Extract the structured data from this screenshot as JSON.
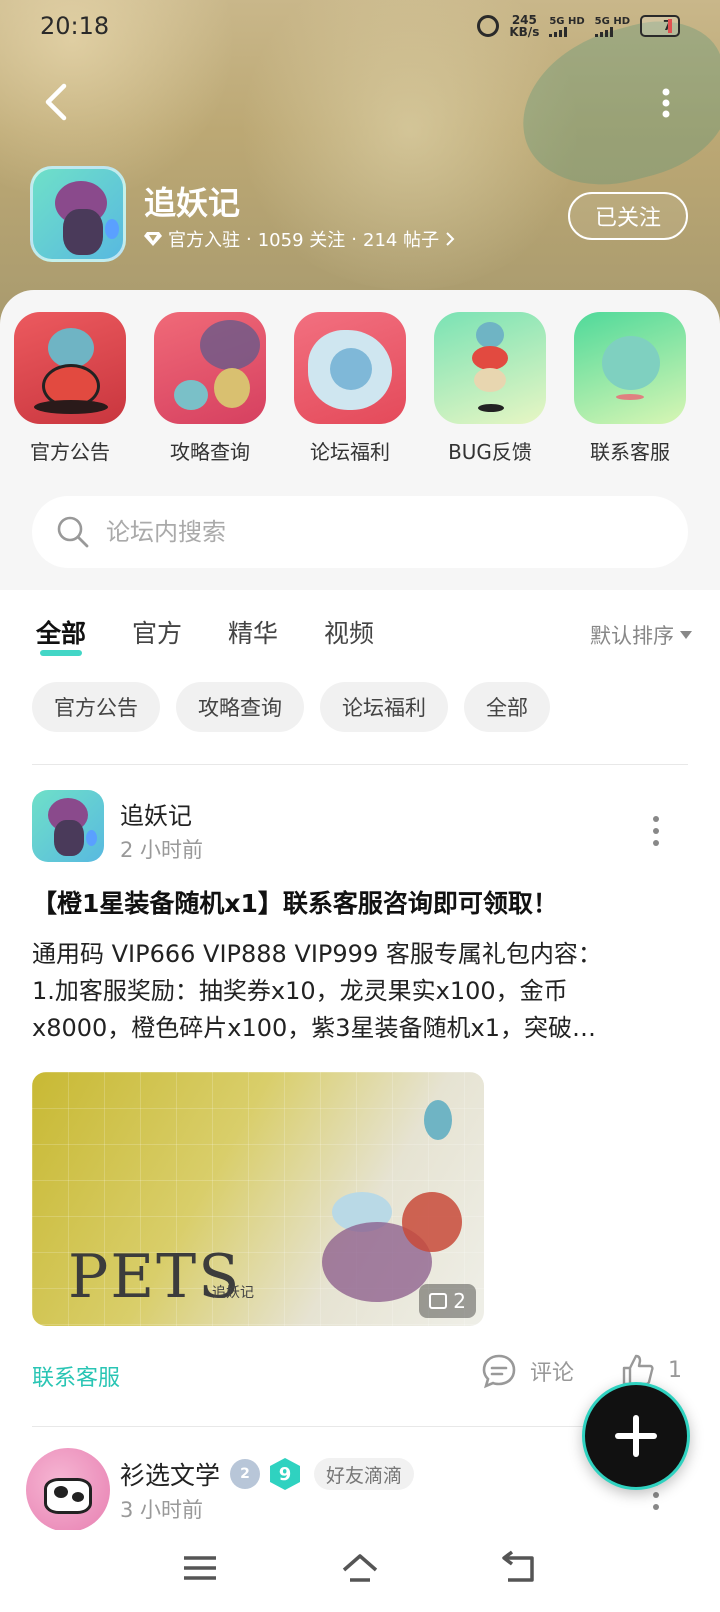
{
  "status": {
    "time": "20:18",
    "net_speed_value": "245",
    "net_speed_unit": "KB/s",
    "sim1": "5G HD",
    "sim2": "5G HD",
    "battery": "7"
  },
  "header": {
    "game_name": "追妖记",
    "verified_label": "官方入驻",
    "followers": "1059 关注",
    "posts": "214 帖子",
    "separator": "·",
    "follow_button": "已关注"
  },
  "shortcuts": [
    {
      "label": "官方公告",
      "color": "#d9434a"
    },
    {
      "label": "攻略查询",
      "color": "#e0506a"
    },
    {
      "label": "论坛福利",
      "color": "#e85a6a"
    },
    {
      "label": "BUG反馈",
      "color": "#6fdc9e"
    },
    {
      "label": "联系客服",
      "color": "#4fd99a"
    }
  ],
  "search": {
    "placeholder": "论坛内搜索"
  },
  "tabs": [
    {
      "label": "全部",
      "active": true
    },
    {
      "label": "官方",
      "active": false
    },
    {
      "label": "精华",
      "active": false
    },
    {
      "label": "视频",
      "active": false
    }
  ],
  "sort_label": "默认排序",
  "chips": [
    "官方公告",
    "攻略查询",
    "论坛福利",
    "全部"
  ],
  "post": {
    "author": "追妖记",
    "time": "2 小时前",
    "title": "【橙1星装备随机x1】联系客服咨询即可领取！",
    "body_line1": "通用码 VIP666 VIP888 VIP999 客服专属礼包内容：",
    "body_line2": "1.加客服奖励：抽奖券x10，龙灵果实x100，金币",
    "body_line3": "x8000，橙色碎片x100，紫3星装备随机x1，突破…",
    "image_text": "PETS",
    "image_subtitle": "追妖记",
    "image_count": "2",
    "tag": "联系客服",
    "comment_label": "评论",
    "like_count": "1"
  },
  "post2": {
    "author": "衫选文学",
    "level_badge": "2",
    "hex_badge": "9",
    "friend_tag": "好友滴滴",
    "time": "3 小时前"
  },
  "colors": {
    "accent": "#2fd2c0",
    "tag": "#29c5b4"
  }
}
